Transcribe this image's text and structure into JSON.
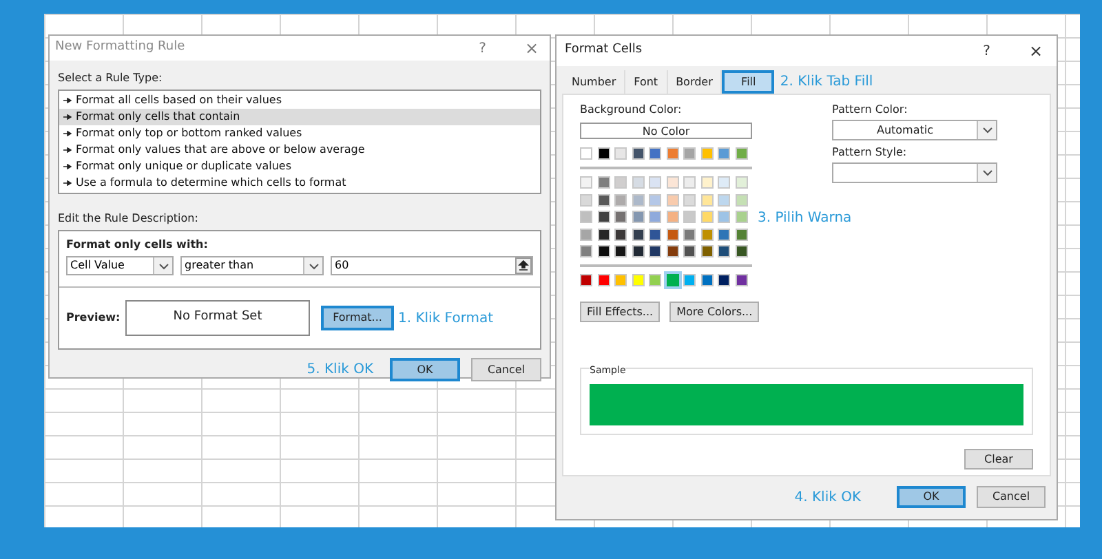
{
  "rule_dialog": {
    "title": "New Formatting Rule",
    "help": "?",
    "close": "×",
    "rule_type_label": "Select a Rule Type:",
    "rule_types": [
      {
        "label": "Format all cells based on their values",
        "selected": false
      },
      {
        "label": "Format only cells that contain",
        "selected": true
      },
      {
        "label": "Format only top or bottom ranked values",
        "selected": false
      },
      {
        "label": "Format only values that are above or below average",
        "selected": false
      },
      {
        "label": "Format only unique or duplicate values",
        "selected": false
      },
      {
        "label": "Use a formula to determine which cells to format",
        "selected": false
      }
    ],
    "description_label": "Edit the Rule Description:",
    "condition_label": "Format only cells with:",
    "condition": {
      "field": "Cell Value",
      "operator": "greater than",
      "value": "60"
    },
    "preview_label": "Preview:",
    "preview_text": "No Format Set",
    "format_button": {
      "label": "Format...",
      "highlighted": true
    },
    "format_step": "1. Klik Format",
    "ok_step": "5. Klik OK",
    "buttons": [
      {
        "label": "OK",
        "highlighted": true
      },
      {
        "label": "Cancel",
        "highlighted": false
      }
    ]
  },
  "format_dialog": {
    "title": "Format Cells",
    "help": "?",
    "close": "×",
    "tabs": [
      {
        "label": "Number",
        "selected": false,
        "highlighted": false
      },
      {
        "label": "Font",
        "selected": false,
        "highlighted": false
      },
      {
        "label": "Border",
        "selected": false,
        "highlighted": false
      },
      {
        "label": "Fill",
        "selected": true,
        "highlighted": true
      }
    ],
    "tab_step": "2. Klik Tab Fill",
    "background_label": "Background Color:",
    "no_color_button": "No Color",
    "theme_colors": [
      {
        "color": "#ffffff",
        "selected": false
      },
      {
        "color": "#000000",
        "selected": false
      },
      {
        "color": "#e7e6e6",
        "selected": false
      },
      {
        "color": "#44546a",
        "selected": false
      },
      {
        "color": "#4472c4",
        "selected": false
      },
      {
        "color": "#ed7d31",
        "selected": false
      },
      {
        "color": "#a5a5a5",
        "selected": false
      },
      {
        "color": "#ffc000",
        "selected": false
      },
      {
        "color": "#5b9bd5",
        "selected": false
      },
      {
        "color": "#70ad47",
        "selected": false
      }
    ],
    "tint_rows": [
      [
        {
          "color": "#f2f2f2",
          "selected": false
        },
        {
          "color": "#7f7f7f",
          "selected": false
        },
        {
          "color": "#d0cece",
          "selected": false
        },
        {
          "color": "#d6dce4",
          "selected": false
        },
        {
          "color": "#dae3f3",
          "selected": false
        },
        {
          "color": "#fbe5d6",
          "selected": false
        },
        {
          "color": "#ededed",
          "selected": false
        },
        {
          "color": "#fff2cc",
          "selected": false
        },
        {
          "color": "#deebf7",
          "selected": false
        },
        {
          "color": "#e2f0d9",
          "selected": false
        }
      ],
      [
        {
          "color": "#d9d9d9",
          "selected": false
        },
        {
          "color": "#595959",
          "selected": false
        },
        {
          "color": "#aeabab",
          "selected": false
        },
        {
          "color": "#adb9ca",
          "selected": false
        },
        {
          "color": "#b4c7e7",
          "selected": false
        },
        {
          "color": "#f8cbad",
          "selected": false
        },
        {
          "color": "#dbdbdb",
          "selected": false
        },
        {
          "color": "#ffe699",
          "selected": false
        },
        {
          "color": "#bdd7ee",
          "selected": false
        },
        {
          "color": "#c5e0b4",
          "selected": false
        }
      ],
      [
        {
          "color": "#bfbfbf",
          "selected": false
        },
        {
          "color": "#404040",
          "selected": false
        },
        {
          "color": "#757171",
          "selected": false
        },
        {
          "color": "#8497b0",
          "selected": false
        },
        {
          "color": "#8faadc",
          "selected": false
        },
        {
          "color": "#f4b183",
          "selected": false
        },
        {
          "color": "#c9c9c9",
          "selected": false
        },
        {
          "color": "#ffd966",
          "selected": false
        },
        {
          "color": "#9dc3e6",
          "selected": false
        },
        {
          "color": "#a9d18e",
          "selected": false
        }
      ],
      [
        {
          "color": "#a6a6a6",
          "selected": false
        },
        {
          "color": "#262626",
          "selected": false
        },
        {
          "color": "#3b3838",
          "selected": false
        },
        {
          "color": "#333f50",
          "selected": false
        },
        {
          "color": "#2f5597",
          "selected": false
        },
        {
          "color": "#c55a11",
          "selected": false
        },
        {
          "color": "#7b7b7b",
          "selected": false
        },
        {
          "color": "#bf9000",
          "selected": false
        },
        {
          "color": "#2e75b6",
          "selected": false
        },
        {
          "color": "#548235",
          "selected": false
        }
      ],
      [
        {
          "color": "#808080",
          "selected": false
        },
        {
          "color": "#0d0d0d",
          "selected": false
        },
        {
          "color": "#171717",
          "selected": false
        },
        {
          "color": "#222a35",
          "selected": false
        },
        {
          "color": "#203864",
          "selected": false
        },
        {
          "color": "#843c0c",
          "selected": false
        },
        {
          "color": "#525252",
          "selected": false
        },
        {
          "color": "#7f6000",
          "selected": false
        },
        {
          "color": "#1f4e79",
          "selected": false
        },
        {
          "color": "#385723",
          "selected": false
        }
      ]
    ],
    "standard_colors": [
      {
        "color": "#c00000",
        "selected": false
      },
      {
        "color": "#ff0000",
        "selected": false
      },
      {
        "color": "#ffc000",
        "selected": false
      },
      {
        "color": "#ffff00",
        "selected": false
      },
      {
        "color": "#92d050",
        "selected": false
      },
      {
        "color": "#00b050",
        "selected": true
      },
      {
        "color": "#00b0f0",
        "selected": false
      },
      {
        "color": "#0070c0",
        "selected": false
      },
      {
        "color": "#002060",
        "selected": false
      },
      {
        "color": "#7030a0",
        "selected": false
      }
    ],
    "color_step": "3. Pilih Warna",
    "effect_buttons": [
      "Fill Effects...",
      "More Colors..."
    ],
    "pattern_color_label": "Pattern Color:",
    "pattern_color": "Automatic",
    "pattern_style_label": "Pattern Style:",
    "sample_label": "Sample",
    "sample_fill": {
      "color": "#00b050"
    },
    "clear_button": "Clear",
    "ok_step": "4. Klik OK",
    "buttons": [
      {
        "label": "OK",
        "highlighted": true
      },
      {
        "label": "Cancel",
        "highlighted": false
      }
    ]
  }
}
